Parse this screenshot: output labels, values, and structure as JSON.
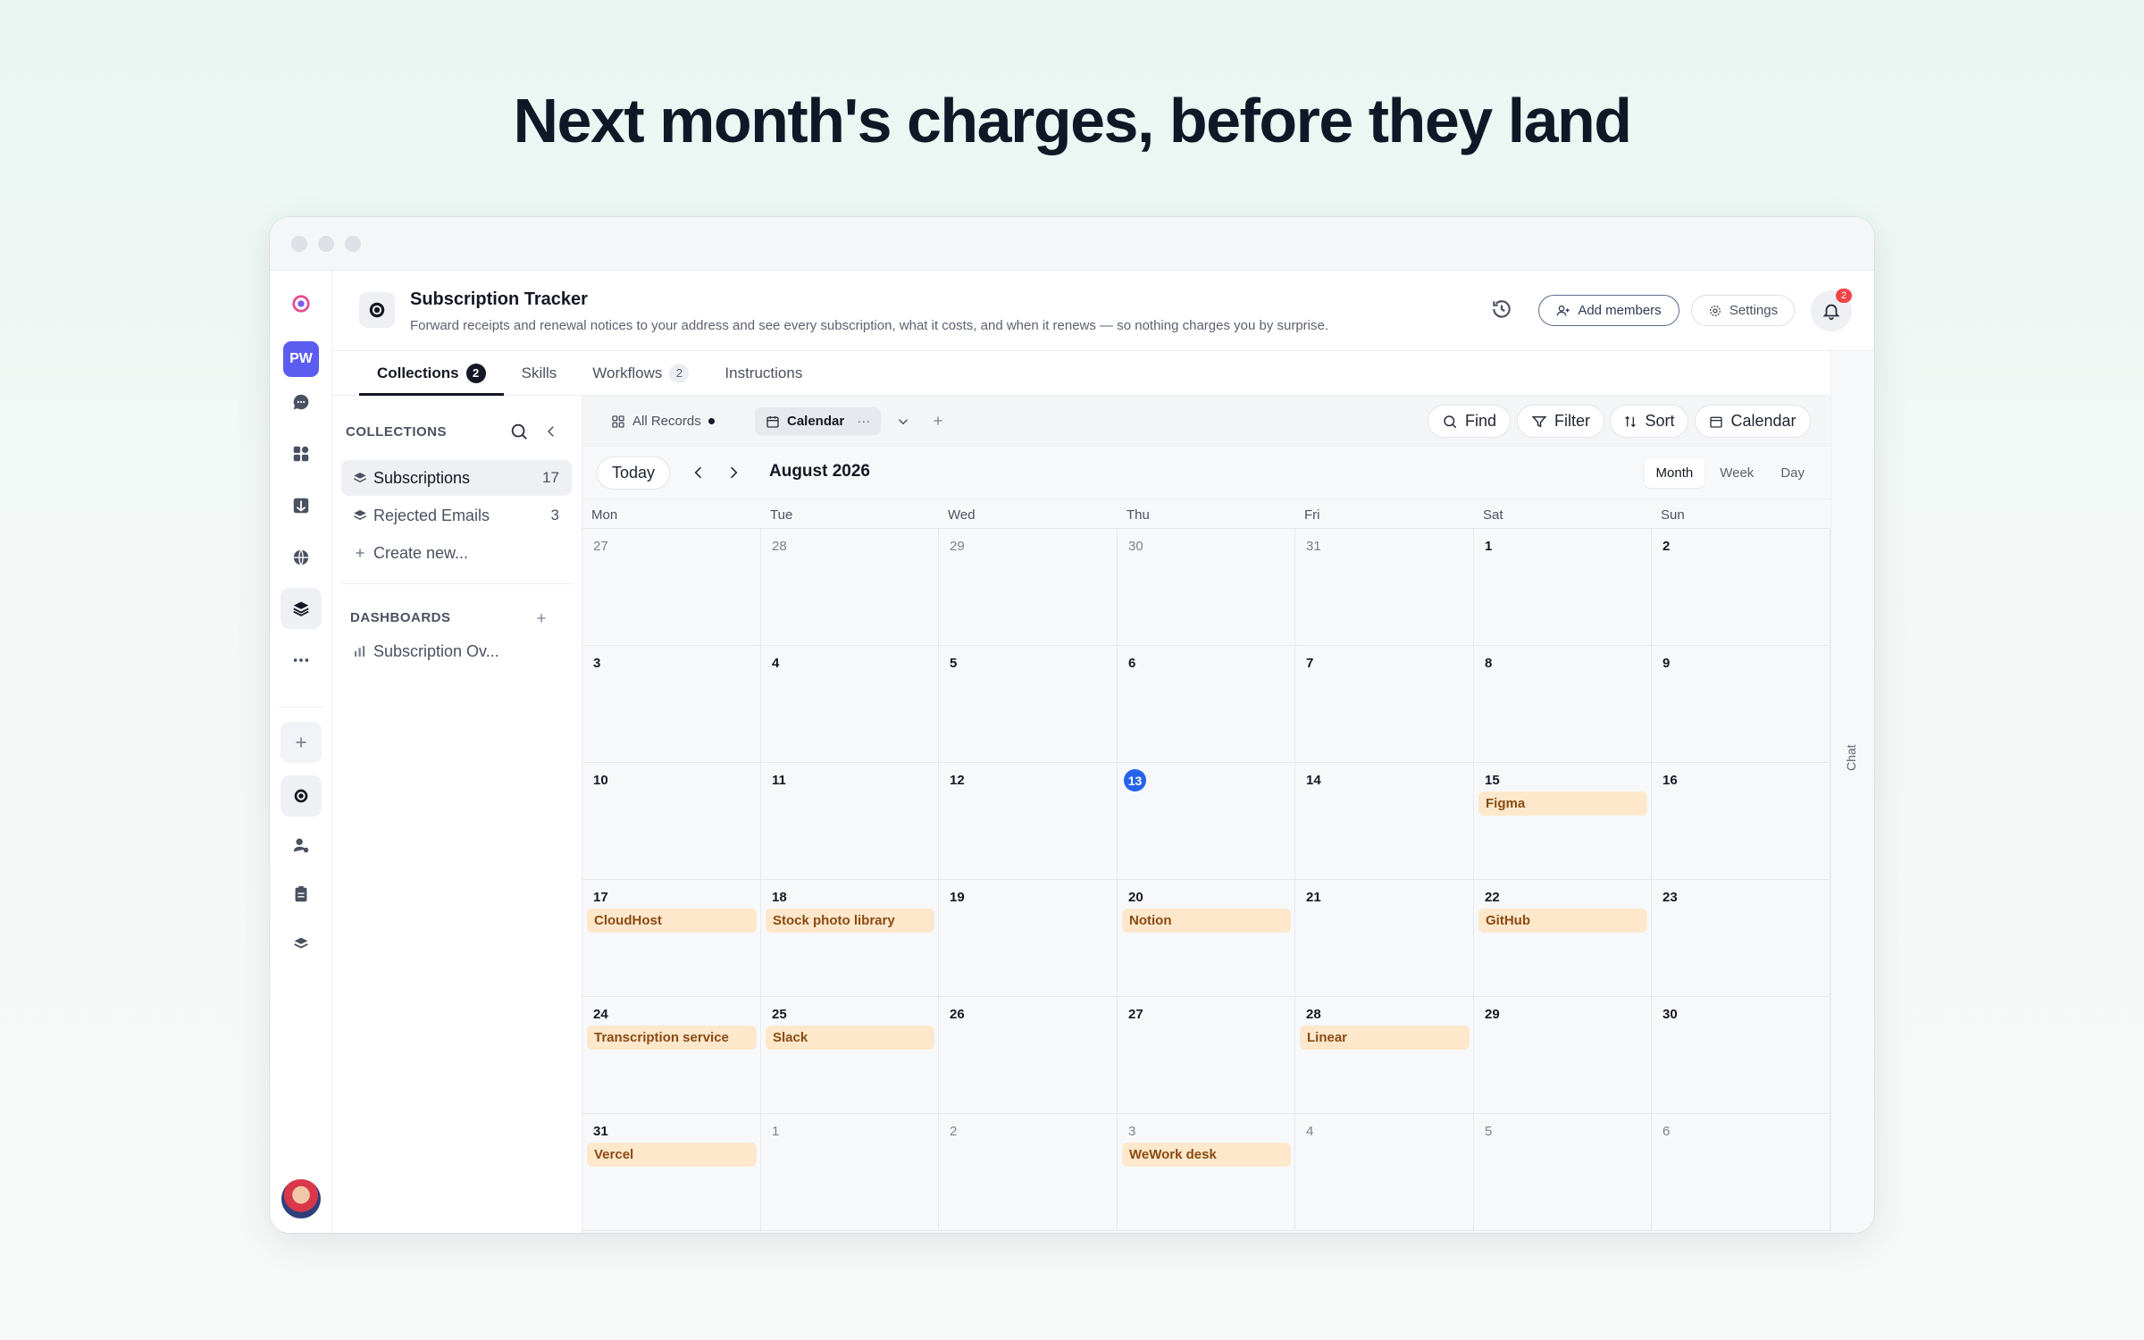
{
  "headline": "Next month's charges, before they land",
  "app": {
    "title": "Subscription Tracker",
    "description": "Forward receipts and renewal notices to your address and see every subscription, what it costs, and when it renews — so nothing charges you by surprise.",
    "add_members_label": "Add members",
    "settings_label": "Settings",
    "notifications_count": "2"
  },
  "rail": {
    "workspace_initials": "PW"
  },
  "tabs": [
    {
      "label": "Collections",
      "badge": "2"
    },
    {
      "label": "Skills",
      "badge": ""
    },
    {
      "label": "Workflows",
      "badge": "2"
    },
    {
      "label": "Instructions",
      "badge": ""
    }
  ],
  "sidebar": {
    "collections_label": "COLLECTIONS",
    "items": [
      {
        "label": "Subscriptions",
        "count": "17"
      },
      {
        "label": "Rejected Emails",
        "count": "3"
      }
    ],
    "create_new_label": "Create new...",
    "dashboards_label": "DASHBOARDS",
    "dashboards": [
      {
        "label": "Subscription Ov..."
      }
    ]
  },
  "toolbar": {
    "views": [
      {
        "label": "All Records"
      },
      {
        "label": "Calendar"
      }
    ],
    "find_label": "Find",
    "filter_label": "Filter",
    "sort_label": "Sort",
    "calendar_label": "Calendar"
  },
  "calendar": {
    "today_label": "Today",
    "month_title": "August 2026",
    "view_modes": [
      "Month",
      "Week",
      "Day"
    ],
    "active_view": "Month",
    "weekdays": [
      "Mon",
      "Tue",
      "Wed",
      "Thu",
      "Fri",
      "Sat",
      "Sun"
    ],
    "today_day": "13",
    "weeks": [
      [
        {
          "day": "27",
          "muted": true
        },
        {
          "day": "28",
          "muted": true
        },
        {
          "day": "29",
          "muted": true
        },
        {
          "day": "30",
          "muted": true
        },
        {
          "day": "31",
          "muted": true
        },
        {
          "day": "1"
        },
        {
          "day": "2"
        }
      ],
      [
        {
          "day": "3"
        },
        {
          "day": "4"
        },
        {
          "day": "5"
        },
        {
          "day": "6"
        },
        {
          "day": "7"
        },
        {
          "day": "8"
        },
        {
          "day": "9"
        }
      ],
      [
        {
          "day": "10"
        },
        {
          "day": "11"
        },
        {
          "day": "12"
        },
        {
          "day": "13",
          "today": true
        },
        {
          "day": "14"
        },
        {
          "day": "15",
          "event": "Figma"
        },
        {
          "day": "16"
        }
      ],
      [
        {
          "day": "17",
          "event": "CloudHost"
        },
        {
          "day": "18",
          "event": "Stock photo library"
        },
        {
          "day": "19"
        },
        {
          "day": "20",
          "event": "Notion"
        },
        {
          "day": "21"
        },
        {
          "day": "22",
          "event": "GitHub"
        },
        {
          "day": "23"
        }
      ],
      [
        {
          "day": "24",
          "event": "Transcription service"
        },
        {
          "day": "25",
          "event": "Slack"
        },
        {
          "day": "26"
        },
        {
          "day": "27"
        },
        {
          "day": "28",
          "event": "Linear"
        },
        {
          "day": "29"
        },
        {
          "day": "30"
        }
      ],
      [
        {
          "day": "31",
          "event": "Vercel"
        },
        {
          "day": "1",
          "muted": true
        },
        {
          "day": "2",
          "muted": true
        },
        {
          "day": "3",
          "muted": true,
          "event": "WeWork desk"
        },
        {
          "day": "4",
          "muted": true
        },
        {
          "day": "5",
          "muted": true
        },
        {
          "day": "6",
          "muted": true
        }
      ]
    ]
  },
  "chat_label": "Chat"
}
